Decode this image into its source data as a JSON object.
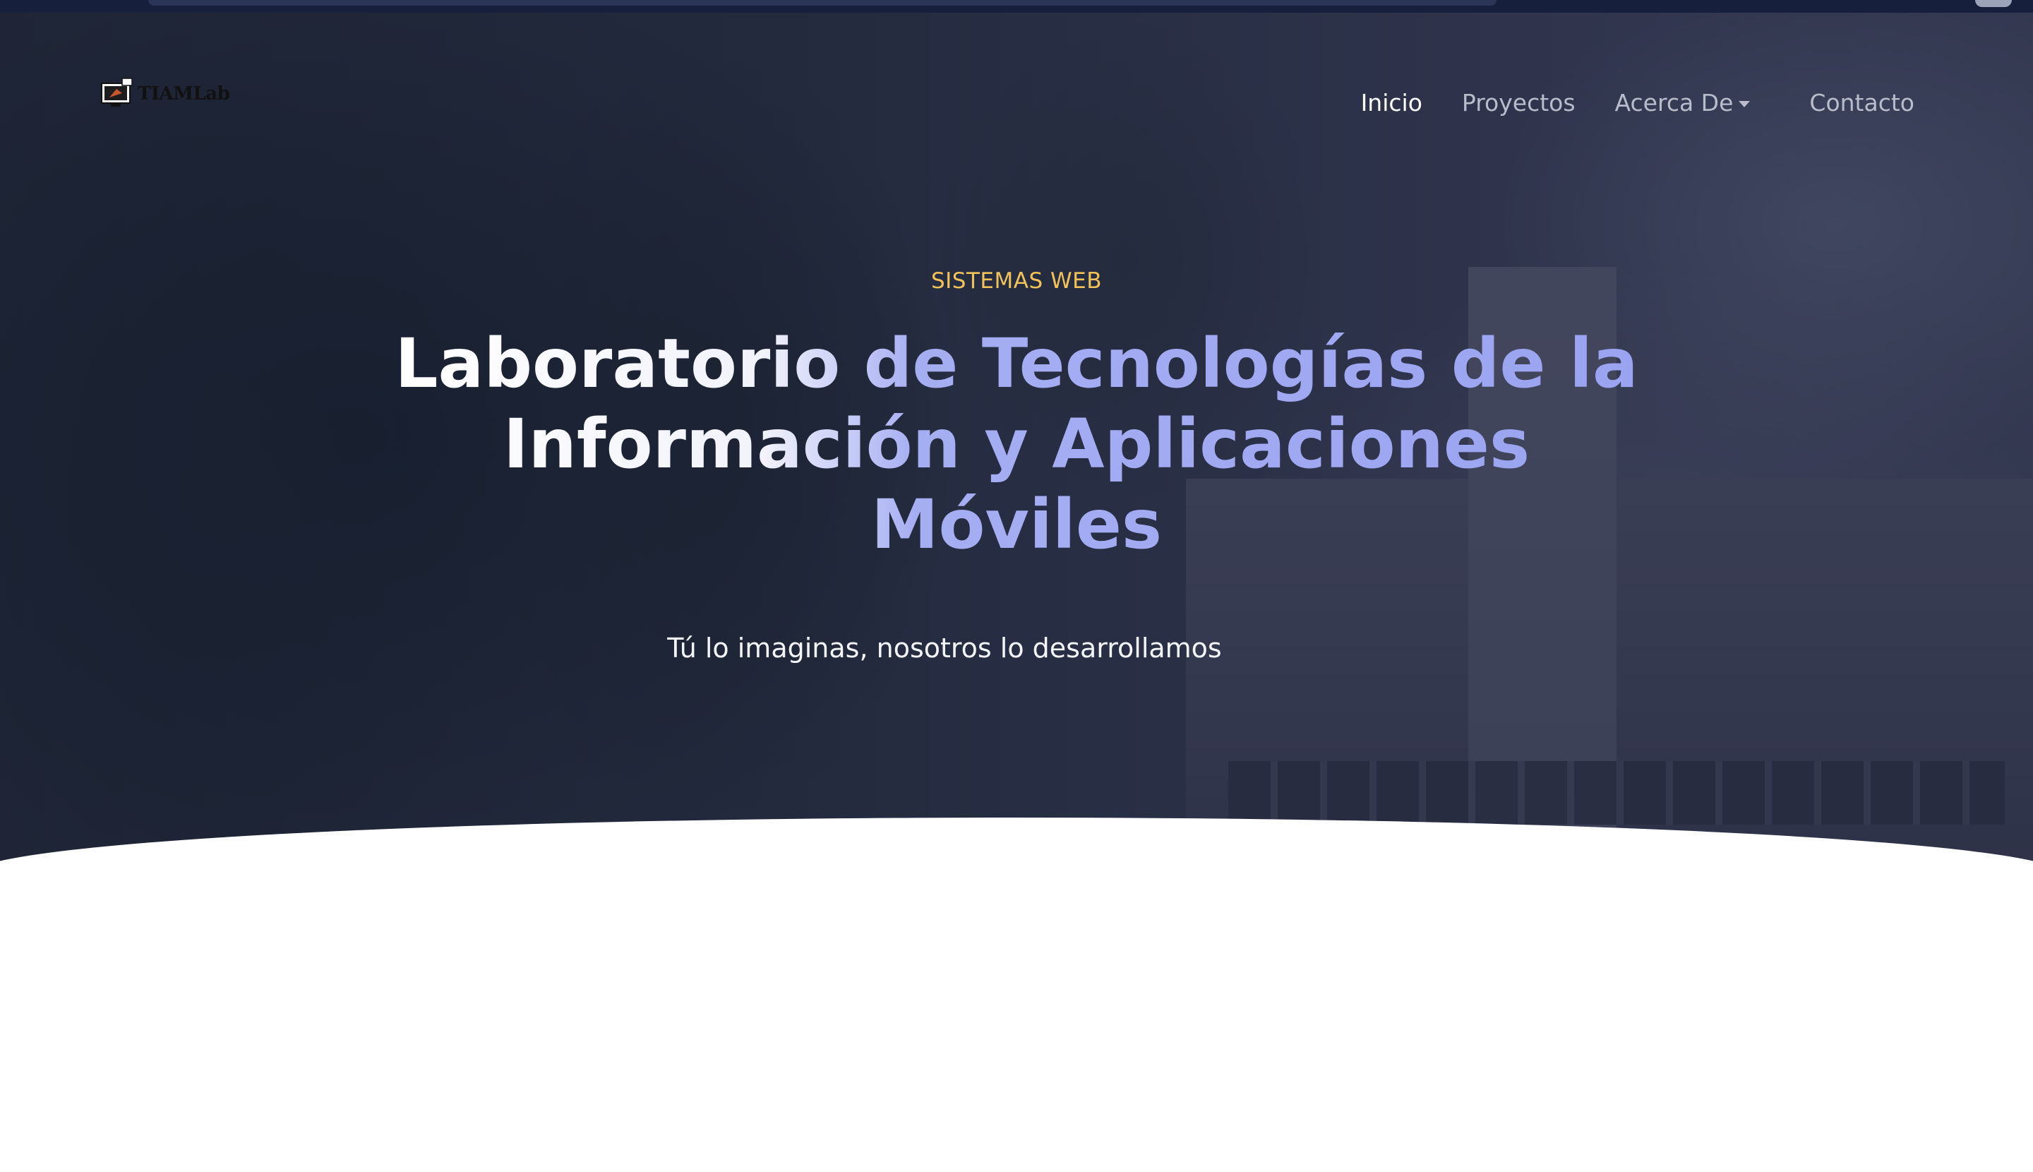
{
  "brand": {
    "name": "TIAMLab"
  },
  "nav": {
    "items": [
      {
        "label": "Inicio",
        "active": true
      },
      {
        "label": "Proyectos",
        "active": false
      },
      {
        "label": "Acerca De",
        "active": false,
        "has_dropdown": true
      },
      {
        "label": "Contacto",
        "active": false
      }
    ]
  },
  "hero": {
    "eyebrow": "SISTEMAS WEB",
    "headline": "Laboratorio de Tecnologías de la Información y Aplicaciones Móviles",
    "tagline": "Tú lo imaginas, nosotros lo desarrollamos"
  },
  "colors": {
    "eyebrow": "#f2c25a",
    "headline_accent": "#9aa3f0",
    "nav_active": "#ffffff",
    "nav_inactive": "#b8bccb",
    "overlay": "#202646"
  },
  "icons": {
    "logo": "monitor-logo-icon",
    "dropdown": "caret-down-icon"
  }
}
